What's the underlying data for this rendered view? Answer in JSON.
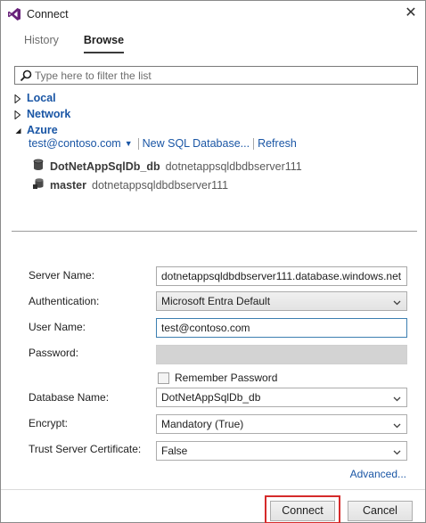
{
  "window": {
    "title": "Connect"
  },
  "tabs": [
    {
      "label": "History"
    },
    {
      "label": "Browse"
    }
  ],
  "filter": {
    "placeholder": "Type here to filter the list"
  },
  "tree": {
    "local": "Local",
    "network": "Network",
    "azure": "Azure"
  },
  "azure": {
    "account": "test@contoso.com",
    "new_db": "New SQL Database...",
    "refresh": "Refresh",
    "databases": [
      {
        "name": "DotNetAppSqlDb_db",
        "server": "dotnetappsqldbdbserver111"
      },
      {
        "name": "master",
        "server": "dotnetappsqldbdbserver111"
      }
    ]
  },
  "form": {
    "server_name": {
      "label": "Server Name:",
      "value": "dotnetappsqldbdbserver111.database.windows.net"
    },
    "authentication": {
      "label": "Authentication:",
      "value": "Microsoft Entra Default"
    },
    "user_name": {
      "label": "User Name:",
      "value": "test@contoso.com"
    },
    "password": {
      "label": "Password:",
      "value": ""
    },
    "remember_password": {
      "label": "Remember Password",
      "checked": false
    },
    "database_name": {
      "label": "Database Name:",
      "value": "DotNetAppSqlDb_db"
    },
    "encrypt": {
      "label": "Encrypt:",
      "value": "Mandatory (True)"
    },
    "trust_server_certificate": {
      "label": "Trust Server Certificate:",
      "value": "False"
    },
    "advanced": "Advanced..."
  },
  "buttons": {
    "connect": "Connect",
    "cancel": "Cancel"
  },
  "colors": {
    "link": "#1a56a5",
    "highlight_border": "#d52b2b",
    "vs_purple": "#68217a"
  }
}
